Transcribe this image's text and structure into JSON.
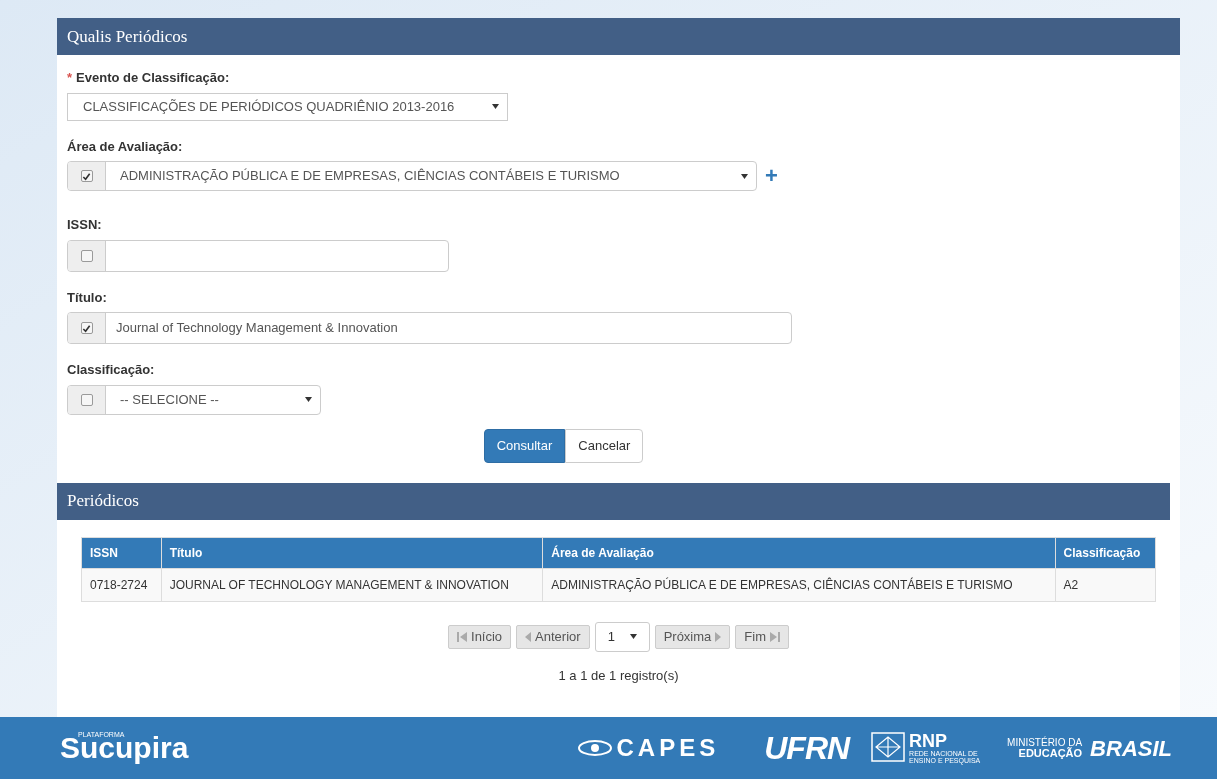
{
  "panel": {
    "title": "Qualis Periódicos"
  },
  "form": {
    "fields": [
      {
        "kind": "select",
        "label": "Evento de Classificação:",
        "required_mark": "*",
        "value": "CLASSIFICAÇÕES DE PERIÓDICOS QUADRIÊNIO 2013-2016"
      },
      {
        "kind": "check-select",
        "label": "Área de Avaliação:",
        "checked": true,
        "value": "ADMINISTRAÇÃO PÚBLICA E DE EMPRESAS, CIÊNCIAS CONTÁBEIS E TURISMO",
        "add": "+"
      },
      {
        "kind": "check-input",
        "label": "ISSN:",
        "checked": false
      },
      {
        "kind": "check-input",
        "label": "Título:",
        "checked": true,
        "value": "Journal of Technology Management & Innovation"
      },
      {
        "kind": "check-select",
        "label": "Classificação:",
        "checked": false,
        "value": "-- SELECIONE --"
      }
    ],
    "buttons": [
      {
        "label": "Consultar",
        "kind": "primary"
      },
      {
        "label": "Cancelar",
        "kind": "default"
      }
    ]
  },
  "results": {
    "title": "Periódicos",
    "table": {
      "columns": [
        "ISSN",
        "Título",
        "Área de Avaliação",
        "Classificação"
      ],
      "rows": [
        [
          "0718-2724",
          "JOURNAL OF TECHNOLOGY MANAGEMENT & INNOVATION",
          "ADMINISTRAÇÃO PÚBLICA E DE EMPRESAS, CIÊNCIAS CONTÁBEIS E TURISMO",
          "A2"
        ]
      ]
    },
    "pagination": {
      "first": "Início",
      "prev": "Anterior",
      "page": "1",
      "next": "Próxima",
      "last": "Fim"
    },
    "summary": "1 a 1 de 1 registro(s)"
  },
  "footer": {
    "sucupira_small": "PLATAFORMA",
    "sucupira": "Sucupira",
    "capes": "CAPES",
    "ufrn": "UFRN",
    "rnp": "RNP",
    "rnp_sub": "REDE NACIONAL DE ENSINO E PESQUISA",
    "ministerio": "MINISTÉRIO DA",
    "educacao": "EDUCAÇÃO",
    "brasil": "BRASIL"
  }
}
